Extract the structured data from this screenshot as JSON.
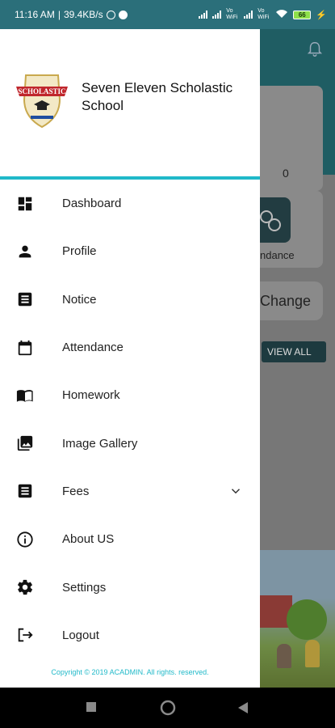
{
  "status_bar": {
    "time": "11:16 AM",
    "speed": "39.4KB/s",
    "network_a": "Vo WiFi",
    "network_b": "Vo WiFi",
    "battery": "66"
  },
  "background_app": {
    "count": "0",
    "attendance_partial": "ndance",
    "change_partial": "Change",
    "view_all": "VIEW ALL"
  },
  "drawer": {
    "school_name": "Seven Eleven Scholastic School",
    "logo_text": "SCHOLASTIC",
    "menu": [
      {
        "label": "Dashboard",
        "icon": "dashboard-icon"
      },
      {
        "label": "Profile",
        "icon": "person-icon"
      },
      {
        "label": "Notice",
        "icon": "notice-icon"
      },
      {
        "label": "Attendance",
        "icon": "calendar-icon"
      },
      {
        "label": "Homework",
        "icon": "book-icon"
      },
      {
        "label": "Image Gallery",
        "icon": "gallery-icon"
      },
      {
        "label": "Fees",
        "icon": "fees-icon",
        "expandable": true
      },
      {
        "label": "About US",
        "icon": "info-icon"
      },
      {
        "label": "Settings",
        "icon": "gear-icon"
      },
      {
        "label": "Logout",
        "icon": "logout-icon"
      }
    ],
    "copyright": "Copyright © 2019 ACADMIN. All rights. reserved."
  },
  "colors": {
    "accent": "#20b9c9",
    "header_bg": "#2b6f7a"
  }
}
